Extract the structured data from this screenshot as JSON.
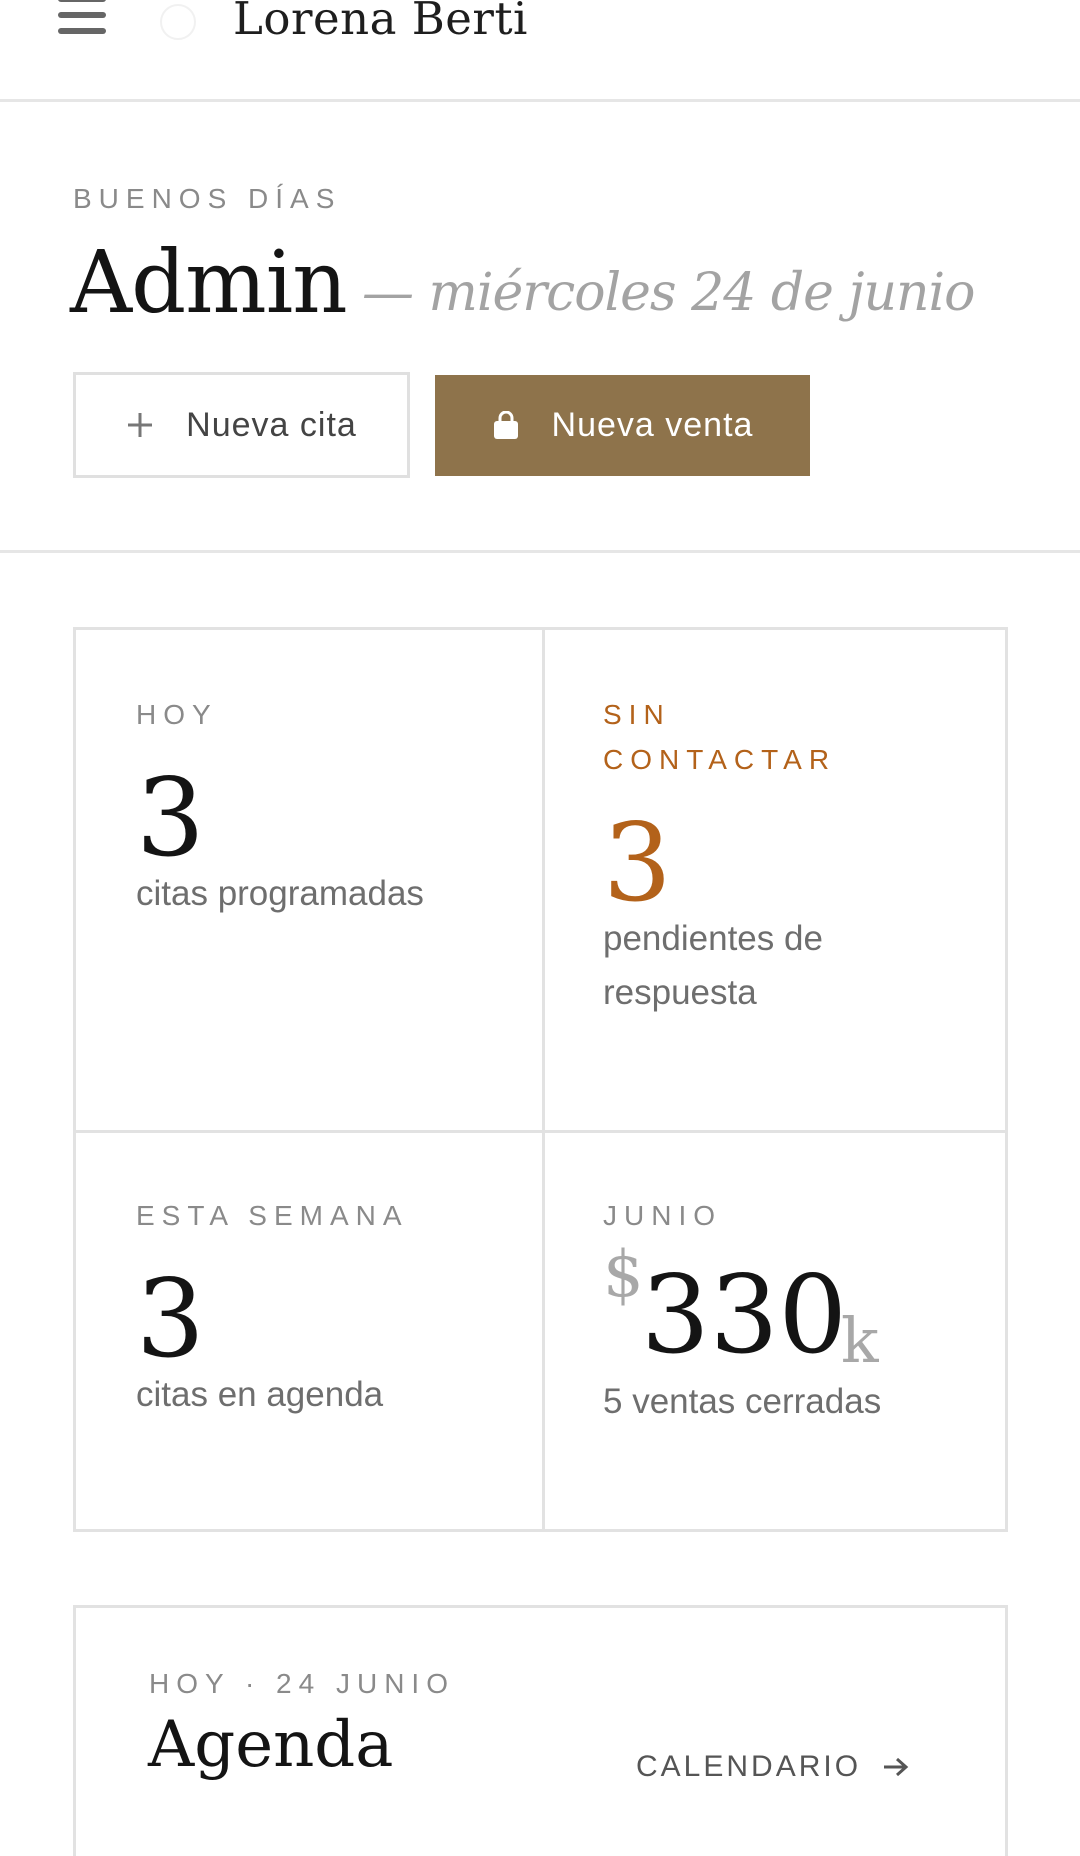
{
  "header": {
    "brand": "Lorena Berti",
    "menu_icon": "hamburger-menu-icon",
    "logo_icon": "brand-logo-icon"
  },
  "hero": {
    "greeting": "BUENOS DÍAS",
    "user": "Admin",
    "date": "— miércoles 24 de junio",
    "new_appointment_label": "Nueva cita",
    "new_appointment_icon": "plus-icon",
    "new_sale_label": "Nueva venta",
    "new_sale_icon": "shopping-bag-icon"
  },
  "stats": {
    "today": {
      "label": "HOY",
      "value": "3",
      "caption": "citas programadas"
    },
    "uncontacted": {
      "label_line1": "SIN",
      "label_line2": "CONTACTAR",
      "value": "3",
      "caption_line1": "pendientes de",
      "caption_line2": "respuesta"
    },
    "week": {
      "label": "ESTA SEMANA",
      "value": "3",
      "caption": "citas en agenda"
    },
    "month": {
      "label": "JUNIO",
      "currency": "$",
      "value": "330",
      "unit": "k",
      "caption": "5 ventas cerradas"
    }
  },
  "agenda": {
    "kicker": "HOY · 24 JUNIO",
    "title": "Agenda",
    "calendar_link": "CALENDARIO",
    "calendar_icon": "arrow-right-icon"
  },
  "colors": {
    "accent": "#8e734b",
    "warning": "#b3621a",
    "muted": "#8a8a8a",
    "border": "#e2e2e2"
  }
}
